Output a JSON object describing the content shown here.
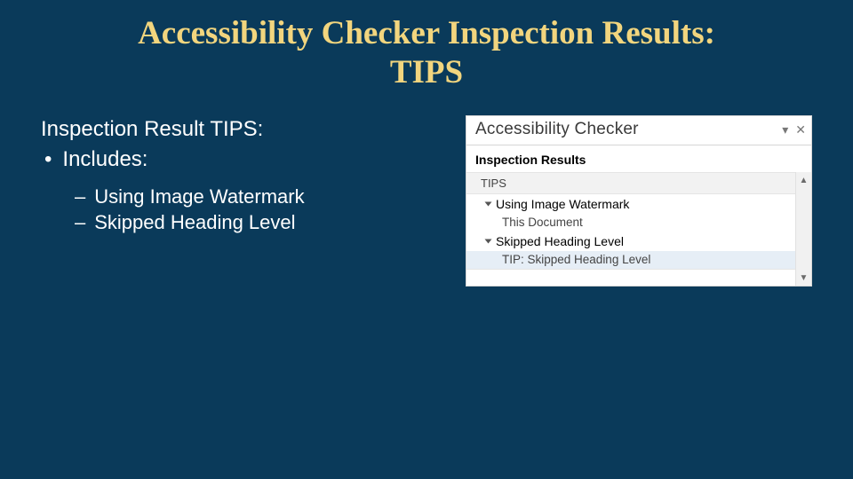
{
  "title_line1": "Accessibility Checker Inspection Results:",
  "title_line2": "TIPS",
  "left": {
    "heading": "Inspection Result TIPS:",
    "b1": "Includes:",
    "b2a": "Using Image Watermark",
    "b2b": "Skipped Heading Level"
  },
  "panel": {
    "title": "Accessibility Checker",
    "subheader": "Inspection Results",
    "tips": "TIPS",
    "item1": "Using Image Watermark",
    "item1_sub": "This Document",
    "item2": "Skipped Heading Level",
    "item2_sub": "TIP: Skipped Heading Level"
  }
}
